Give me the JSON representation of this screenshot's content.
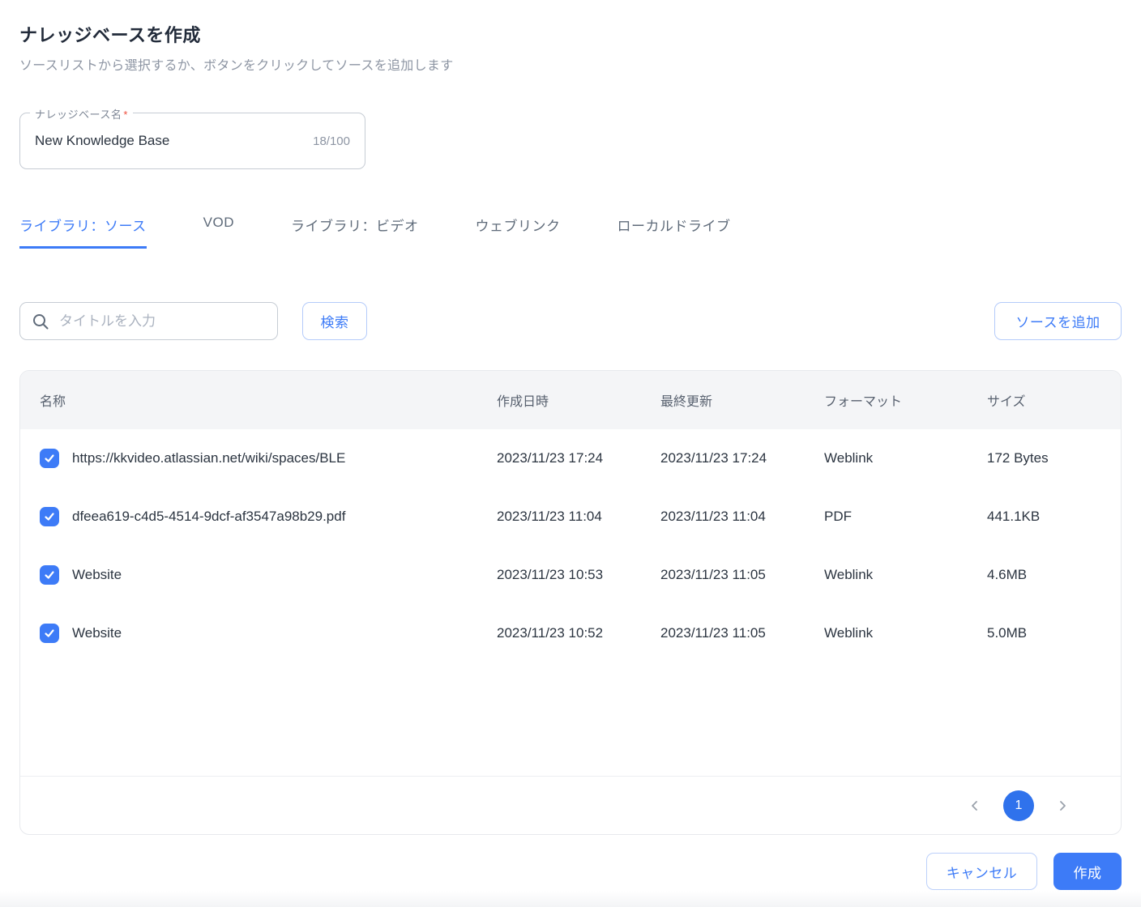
{
  "page": {
    "title": "ナレッジベースを作成",
    "subtitle": "ソースリストから選択するか、ボタンをクリックしてソースを追加します"
  },
  "name_field": {
    "label": "ナレッジベース名",
    "required_mark": "*",
    "value": "New Knowledge Base",
    "counter": "18/100"
  },
  "tabs": [
    {
      "label": "ライブラリ：ソース",
      "active": true
    },
    {
      "label": "VOD",
      "active": false
    },
    {
      "label": "ライブラリ：ビデオ",
      "active": false
    },
    {
      "label": "ウェブリンク",
      "active": false
    },
    {
      "label": "ローカルドライブ",
      "active": false
    }
  ],
  "search": {
    "placeholder": "タイトルを入力",
    "button_label": "検索"
  },
  "add_source_label": "ソースを追加",
  "table": {
    "columns": [
      "名称",
      "作成日時",
      "最終更新",
      "フォーマット",
      "サイズ"
    ],
    "rows": [
      {
        "checked": true,
        "name": "https://kkvideo.atlassian.net/wiki/spaces/BLE",
        "created": "2023/11/23 17:24",
        "updated": "2023/11/23 17:24",
        "format": "Weblink",
        "size": "172 Bytes"
      },
      {
        "checked": true,
        "name": "dfeea619-c4d5-4514-9dcf-af3547a98b29.pdf",
        "created": "2023/11/23 11:04",
        "updated": "2023/11/23 11:04",
        "format": "PDF",
        "size": "441.1KB"
      },
      {
        "checked": true,
        "name": "Website",
        "created": "2023/11/23 10:53",
        "updated": "2023/11/23 11:05",
        "format": "Weblink",
        "size": "4.6MB"
      },
      {
        "checked": true,
        "name": "Website",
        "created": "2023/11/23 10:52",
        "updated": "2023/11/23 11:05",
        "format": "Weblink",
        "size": "5.0MB"
      }
    ]
  },
  "pagination": {
    "current_page": "1"
  },
  "footer": {
    "cancel_label": "キャンセル",
    "create_label": "作成"
  },
  "colors": {
    "primary_blue": "#3d7bf7",
    "pagination_blue": "#2f72ec",
    "required_red": "#ee4e3c",
    "header_bg": "#f4f5f7",
    "card_border": "#e7e9ed",
    "title_text": "#222b3a",
    "muted_text": "#8d95a3"
  }
}
